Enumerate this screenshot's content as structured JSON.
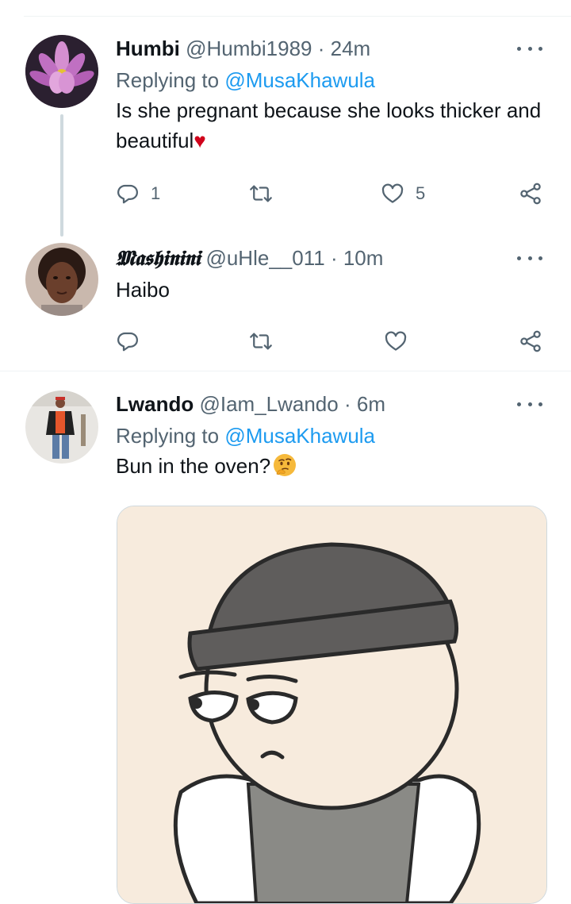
{
  "tweets": [
    {
      "display_name": "Humbi",
      "handle": "@Humbi1989",
      "separator": "·",
      "time": "24m",
      "replying_prefix": "Replying to",
      "replying_to": "@MusaKhawula",
      "text": "Is she pregnant because she looks thicker and beautiful",
      "emoji": "♥",
      "replies": "1",
      "retweets": "",
      "likes": "5"
    },
    {
      "display_name": "𝕸𝖆𝖘𝖍𝖎𝖓𝖎𝖓𝖎",
      "handle": "@uHle__011",
      "separator": "·",
      "time": "10m",
      "text": "Haibo",
      "replies": "",
      "retweets": "",
      "likes": ""
    },
    {
      "display_name": "Lwando",
      "handle": "@Iam_Lwando",
      "separator": "·",
      "time": "6m",
      "replying_prefix": "Replying to",
      "replying_to": "@MusaKhawula",
      "text": "Bun in the oven?",
      "emoji_name": "thinking-face"
    }
  ],
  "colors": {
    "link": "#1d9bf0",
    "secondary_text": "#536471",
    "heart": "#d0021b",
    "divider": "#eff3f4"
  },
  "icons": [
    "reply-icon",
    "retweet-icon",
    "like-icon",
    "share-icon",
    "more-icon"
  ]
}
